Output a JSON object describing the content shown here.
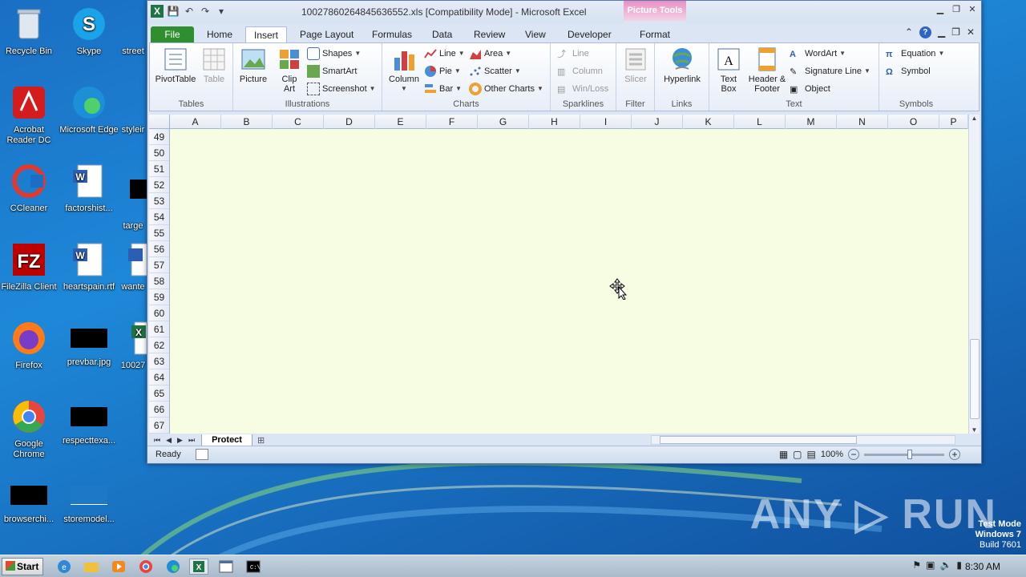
{
  "desktop": {
    "icons": [
      {
        "label": "Recycle Bin"
      },
      {
        "label": "Skype"
      },
      {
        "label": "street"
      },
      {
        "label": "Acrobat Reader DC"
      },
      {
        "label": "Microsoft Edge"
      },
      {
        "label": "styleir"
      },
      {
        "label": "CCleaner"
      },
      {
        "label": "factorshist..."
      },
      {
        "label": "targe"
      },
      {
        "label": "FileZilla Client"
      },
      {
        "label": "heartspain.rtf"
      },
      {
        "label": "wante"
      },
      {
        "label": "Firefox"
      },
      {
        "label": "prevbar.jpg"
      },
      {
        "label": "10027"
      },
      {
        "label": "Google Chrome"
      },
      {
        "label": "respecttexa..."
      },
      {
        "label": "browserchi..."
      },
      {
        "label": "storemodel..."
      }
    ],
    "watermark": "ANY ▷ RUN",
    "test_mode": {
      "line1": "Test Mode",
      "line2": "Windows 7",
      "line3": "Build 7601"
    }
  },
  "excel": {
    "title": "10027860264845636552.xls  [Compatibility Mode]  -  Microsoft Excel",
    "picture_tools": "Picture Tools",
    "tabs": [
      "File",
      "Home",
      "Insert",
      "Page Layout",
      "Formulas",
      "Data",
      "Review",
      "View",
      "Developer",
      "Format"
    ],
    "active_tab": "Insert",
    "ribbon": {
      "tables": {
        "label": "Tables",
        "pivot": "PivotTable",
        "table": "Table"
      },
      "illustrations": {
        "label": "Illustrations",
        "picture": "Picture",
        "clipart": "Clip Art",
        "shapes": "Shapes",
        "smartart": "SmartArt",
        "screenshot": "Screenshot"
      },
      "charts": {
        "label": "Charts",
        "column": "Column",
        "line": "Line",
        "pie": "Pie",
        "bar": "Bar",
        "area": "Area",
        "scatter": "Scatter",
        "other": "Other Charts"
      },
      "sparklines": {
        "label": "Sparklines",
        "line": "Line",
        "column": "Column",
        "winloss": "Win/Loss"
      },
      "filter": {
        "label": "Filter",
        "slicer": "Slicer"
      },
      "links": {
        "label": "Links",
        "hyperlink": "Hyperlink"
      },
      "text": {
        "label": "Text",
        "textbox": "Text Box",
        "header": "Header & Footer",
        "wordart": "WordArt",
        "signature": "Signature Line",
        "object": "Object"
      },
      "symbols": {
        "label": "Symbols",
        "equation": "Equation",
        "symbol": "Symbol"
      }
    },
    "columns": [
      "A",
      "B",
      "C",
      "D",
      "E",
      "F",
      "G",
      "H",
      "I",
      "J",
      "K",
      "L",
      "M",
      "N",
      "O",
      "P"
    ],
    "rows": [
      "49",
      "50",
      "51",
      "52",
      "53",
      "54",
      "55",
      "56",
      "57",
      "58",
      "59",
      "60",
      "61",
      "62",
      "63",
      "64",
      "65",
      "66",
      "67"
    ],
    "sheet_tab": "Protect",
    "status": "Ready",
    "zoom": "100%"
  },
  "taskbar": {
    "start": "Start",
    "time": "8:30 AM"
  }
}
